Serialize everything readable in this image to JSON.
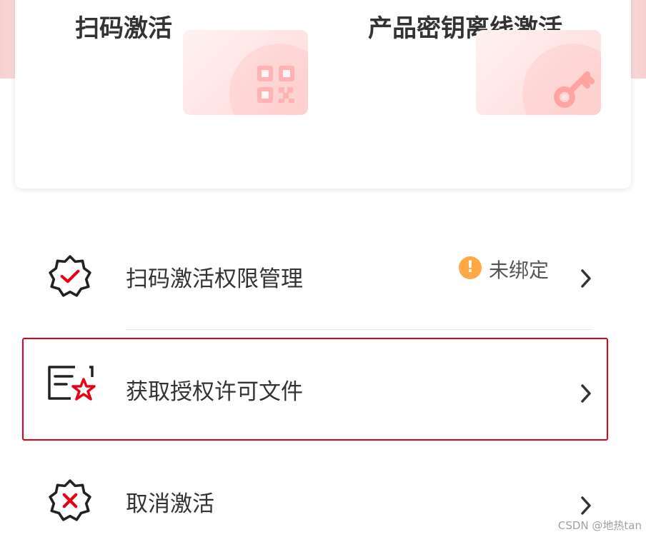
{
  "activation_options": [
    {
      "title": "扫码激活",
      "icon": "qr-code-icon"
    },
    {
      "title": "产品密钥离线激活",
      "icon": "key-icon"
    }
  ],
  "menu": {
    "items": [
      {
        "label": "扫码激活权限管理",
        "icon": "badge-check-icon",
        "status": {
          "icon": "warning-icon",
          "icon_glyph": "!",
          "text": "未绑定"
        }
      },
      {
        "label": "获取授权许可文件",
        "icon": "license-file-star-icon"
      },
      {
        "label": "取消激活",
        "icon": "badge-x-icon"
      }
    ]
  },
  "watermark": "CSDN @地热tan",
  "colors": {
    "accent_red": "#e60012",
    "warning_orange": "#ffa845",
    "tile_pink": "#ffd9d9",
    "text_dark": "#333333"
  }
}
